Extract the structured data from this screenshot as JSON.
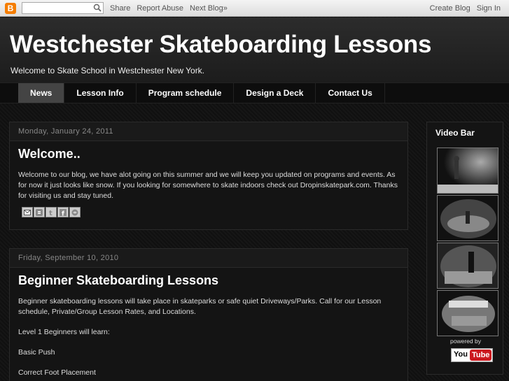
{
  "navbar": {
    "logo_letter": "B",
    "links": [
      "Share",
      "Report Abuse",
      "Next Blog»"
    ],
    "right_links": [
      "Create Blog",
      "Sign In"
    ]
  },
  "header": {
    "title": "Westchester Skateboarding Lessons",
    "description": "Welcome to Skate School in Westchester New York."
  },
  "tabs": [
    {
      "label": "News",
      "active": true
    },
    {
      "label": "Lesson Info"
    },
    {
      "label": "Program schedule"
    },
    {
      "label": "Design a Deck"
    },
    {
      "label": "Contact Us"
    }
  ],
  "posts": [
    {
      "date": "Monday, January 24, 2011",
      "title": "Welcome..",
      "paragraphs": [
        "Welcome to our blog, we have alot going on this summer and we will keep you updated on programs and events. As for now it just looks like snow. If you looking for somewhere to skate indoors check out Dropinskatepark.com. Thanks for visiting us and stay tuned."
      ],
      "share_icons": [
        "email-icon",
        "blogthis-icon",
        "twitter-icon",
        "facebook-icon",
        "buzz-icon"
      ]
    },
    {
      "date": "Friday, September 10, 2010",
      "title": "Beginner Skateboarding Lessons",
      "paragraphs": [
        "Beginner skateboarding lessons will take place in skateparks or safe quiet Driveways/Parks. Call for our Lesson schedule, Private/Group Lesson Rates, and Locations.",
        "Level 1 Beginners will learn:",
        "Basic Push",
        "Correct Foot Placement"
      ]
    }
  ],
  "sidebar": {
    "title": "Video Bar",
    "videos": [
      "video-thumb-1",
      "video-thumb-2",
      "video-thumb-3",
      "video-thumb-4"
    ],
    "powered_by": "powered by",
    "youtube_you": "You",
    "youtube_tube": "Tube"
  },
  "colors": {
    "background": "#111111",
    "post_bg": "#141414",
    "active_tab": "#444444",
    "logo": "#f57d00",
    "youtube_red": "#cc181e"
  }
}
